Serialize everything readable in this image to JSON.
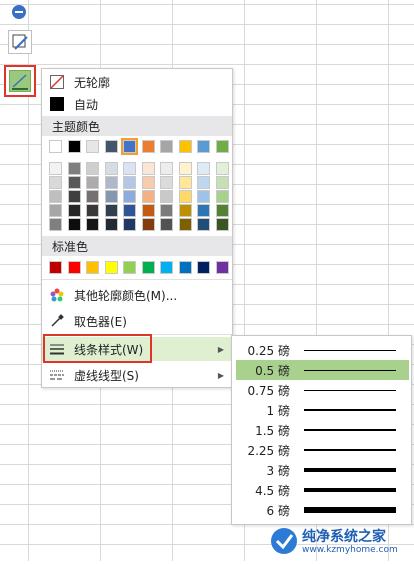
{
  "menu": {
    "no_outline": "无轮廓",
    "auto": "自动",
    "theme_colors_title": "主题颜色",
    "standard_colors_title": "标准色",
    "more_colors": "其他轮廓颜色(M)...",
    "eyedropper": "取色器(E)",
    "line_style": "线条样式(W)",
    "dash_style": "虚线线型(S)"
  },
  "theme_colors": [
    [
      "#ffffff",
      "#000000",
      "#e7e6e6",
      "#44546a",
      "#4472c4",
      "#ed7d31",
      "#a5a5a5",
      "#ffc000",
      "#5b9bd5",
      "#70ad47"
    ],
    [
      "#f2f2f2",
      "#7f7f7f",
      "#d0cece",
      "#d6dce4",
      "#dae3f3",
      "#fbe5d6",
      "#ededed",
      "#fff2cc",
      "#deebf7",
      "#e2f0d9"
    ],
    [
      "#d9d9d9",
      "#595959",
      "#aeabab",
      "#adb9ca",
      "#b4c7e7",
      "#f8cbad",
      "#dbdbdb",
      "#ffe699",
      "#bdd7ee",
      "#c5e0b4"
    ],
    [
      "#bfbfbf",
      "#404040",
      "#757171",
      "#8497b0",
      "#8faadc",
      "#f4b183",
      "#c9c9c9",
      "#ffd966",
      "#9dc3e6",
      "#a9d18e"
    ],
    [
      "#a6a6a6",
      "#262626",
      "#3a3838",
      "#323f4f",
      "#2f5597",
      "#c55a11",
      "#7b7b7b",
      "#bf9000",
      "#2e75b6",
      "#548235"
    ],
    [
      "#7f7f7f",
      "#0d0d0d",
      "#171616",
      "#222a35",
      "#203864",
      "#843c0c",
      "#525252",
      "#7f6000",
      "#1f4e79",
      "#385723"
    ]
  ],
  "standard_colors": [
    "#c00000",
    "#ff0000",
    "#ffc000",
    "#ffff00",
    "#92d050",
    "#00b050",
    "#00b0f0",
    "#0070c0",
    "#002060",
    "#7030a0"
  ],
  "line_weights": [
    {
      "label": "0.25 磅",
      "weight": 0.25
    },
    {
      "label": "0.5 磅",
      "weight": 0.5
    },
    {
      "label": "0.75 磅",
      "weight": 0.75
    },
    {
      "label": "1 磅",
      "weight": 1
    },
    {
      "label": "1.5 磅",
      "weight": 1.5
    },
    {
      "label": "2.25 磅",
      "weight": 2.25
    },
    {
      "label": "3 磅",
      "weight": 3
    },
    {
      "label": "4.5 磅",
      "weight": 4.5
    },
    {
      "label": "6 磅",
      "weight": 6
    }
  ],
  "selected_weight_index": 1,
  "watermark": {
    "title": "纯净系统之家",
    "url": "www.kzmyhome.com"
  },
  "colors": {
    "accent_red": "#e0342b",
    "highlight_green": "#a9d18e",
    "hover_green": "#dff0d0"
  }
}
